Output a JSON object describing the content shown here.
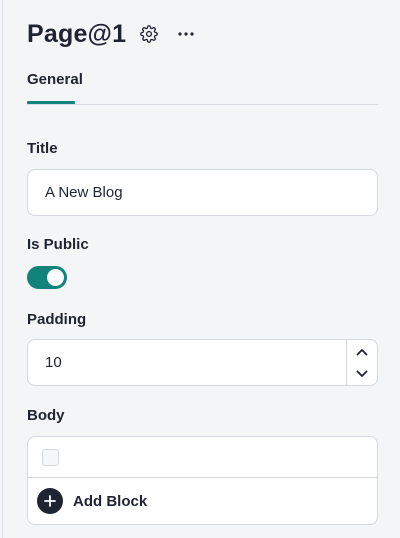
{
  "header": {
    "title": "Page@1",
    "settings_icon": "gear-icon",
    "more_icon": "more-horizontal-icon"
  },
  "tabs": [
    {
      "label": "General",
      "active": true
    }
  ],
  "fields": {
    "title": {
      "label": "Title",
      "value": "A New Blog"
    },
    "is_public": {
      "label": "Is Public",
      "checked": true
    },
    "padding": {
      "label": "Padding",
      "value": "10"
    },
    "body": {
      "label": "Body",
      "add_label": "Add Block"
    }
  },
  "colors": {
    "accent": "#12837b",
    "text": "#1f2433",
    "background": "#f4f5f7",
    "border": "#d4d8de"
  }
}
